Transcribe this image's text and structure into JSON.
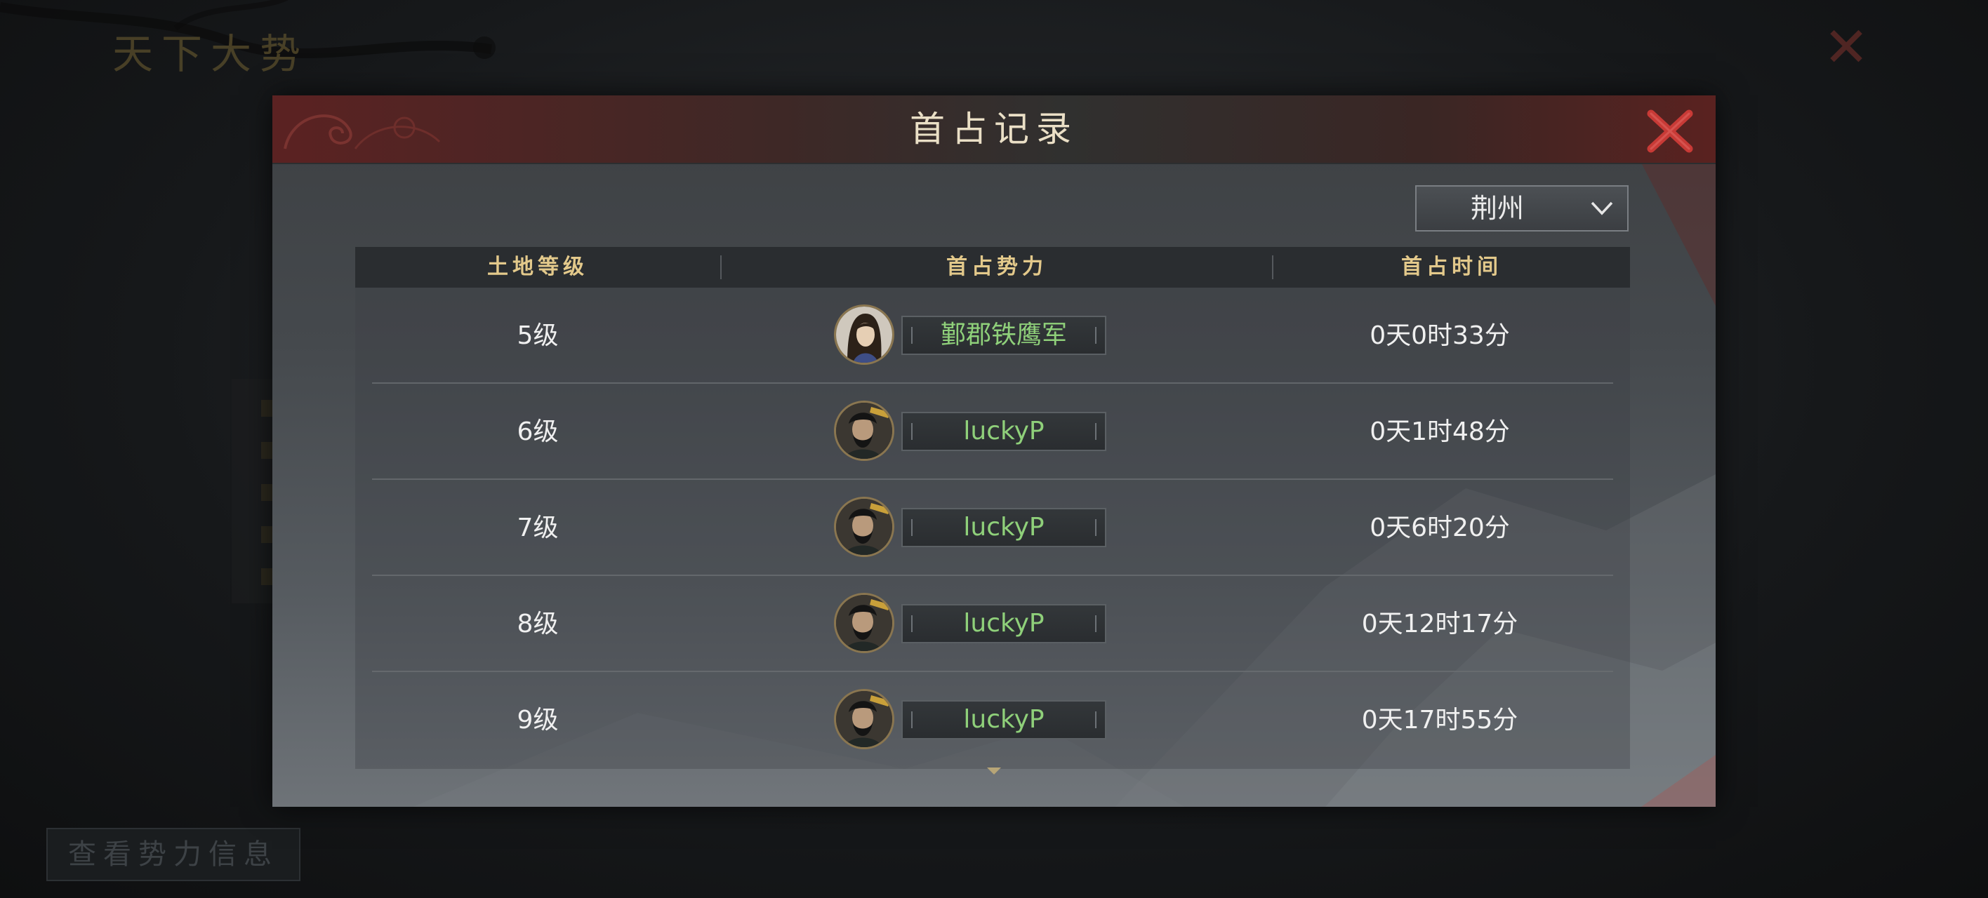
{
  "background": {
    "title": "天下大势",
    "bottom_button": "查看势力信息"
  },
  "dialog": {
    "title": "首占记录",
    "region_select": {
      "value": "荆州"
    },
    "columns": {
      "level": "土地等级",
      "faction": "首占势力",
      "time": "首占时间"
    },
    "rows": [
      {
        "level": "5级",
        "faction": "鄞郡铁鹰军",
        "time": "0天0时33分",
        "avatar": "female-hero-portrait"
      },
      {
        "level": "6级",
        "faction": "luckyP",
        "time": "0天1时48分",
        "avatar": "bearded-warrior-portrait"
      },
      {
        "level": "7级",
        "faction": "luckyP",
        "time": "0天6时20分",
        "avatar": "bearded-warrior-portrait"
      },
      {
        "level": "8级",
        "faction": "luckyP",
        "time": "0天12时17分",
        "avatar": "bearded-warrior-portrait"
      },
      {
        "level": "9级",
        "faction": "luckyP",
        "time": "0天17时55分",
        "avatar": "bearded-warrior-portrait"
      }
    ]
  },
  "colors": {
    "title_text": "#eadfc6",
    "header_text": "#e3c98b",
    "faction_text": "#8fd07a",
    "close_red": "#c83a36"
  }
}
